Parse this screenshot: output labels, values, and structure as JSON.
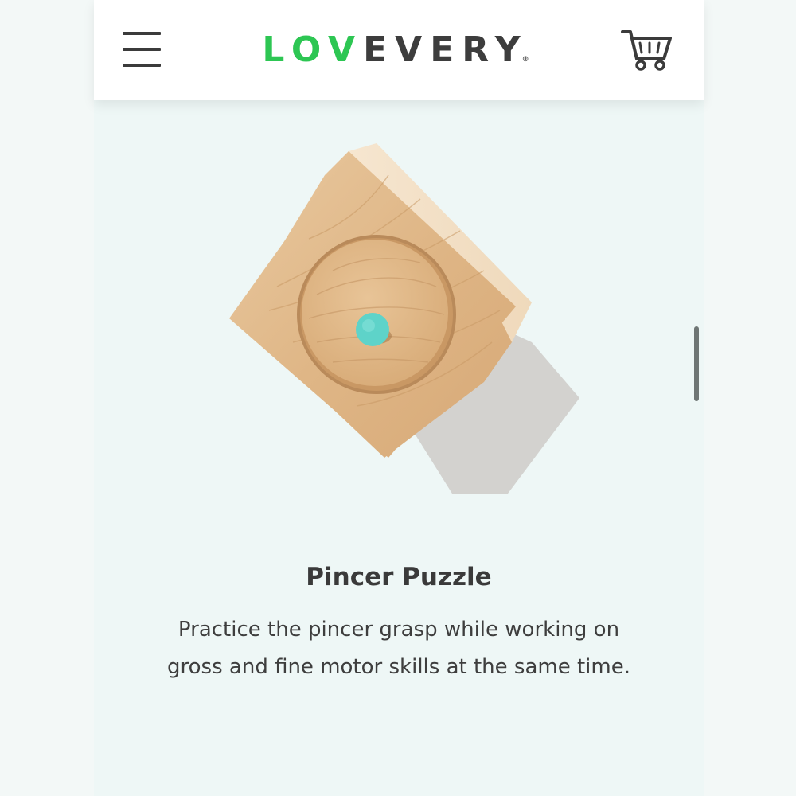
{
  "header": {
    "logo_part1": "LOV",
    "logo_part2": "EVERY",
    "logo_reg": "®",
    "menu_icon": "hamburger-menu-icon",
    "cart_icon": "shopping-cart-icon"
  },
  "product": {
    "title": "Pincer Puzzle",
    "description": "Practice the pincer grasp while working on gross and fine motor skills at the same time."
  },
  "colors": {
    "brand_green": "#2dc653",
    "text_dark": "#3d3d3d",
    "background": "#eef7f6",
    "peg": "#5ed3c9"
  }
}
